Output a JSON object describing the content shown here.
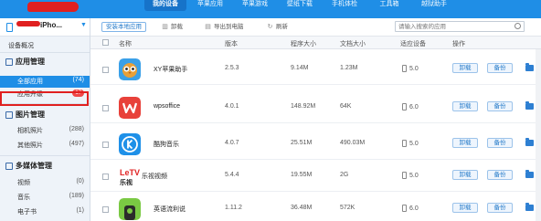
{
  "nav": {
    "items": [
      "我的设备",
      "苹果应用",
      "苹果游戏",
      "壁纸下载",
      "手机体检",
      "工具箱",
      "越狱助手"
    ],
    "active_index": 0
  },
  "sidebar": {
    "device_name": "iPho...",
    "device_overview": "设备概况",
    "app_section": "应用管理",
    "all_apps": "全部应用",
    "all_apps_count": "(74)",
    "app_updates": "应用升级",
    "app_updates_count": "17",
    "photo_section": "图片管理",
    "camera_photos": "相机照片",
    "camera_photos_count": "(288)",
    "other_photos": "其他照片",
    "other_photos_count": "(497)",
    "media_section": "多媒体管理",
    "video": "视频",
    "video_count": "(0)",
    "music": "音乐",
    "music_count": "(189)",
    "ebook": "电子书",
    "ebook_count": "(1)"
  },
  "toolbar": {
    "install_local": "安装本地应用",
    "uninstall": "卸载",
    "export_pc": "导出到电脑",
    "refresh": "刷新",
    "search_placeholder": "请输入搜索的应用"
  },
  "table": {
    "headers": {
      "name": "名称",
      "version": "版本",
      "app_size": "程序大小",
      "doc_size": "文档大小",
      "device": "适应设备",
      "actions": "操作"
    },
    "uninstall_label": "卸载",
    "backup_label": "备份",
    "rows": [
      {
        "name": "XY苹果助手",
        "version": "2.5.3",
        "app_size": "9.14M",
        "doc_size": "1.23M",
        "device": "5.0",
        "icon": "xy-owl-icon"
      },
      {
        "name": "wpsoffice",
        "version": "4.0.1",
        "app_size": "148.92M",
        "doc_size": "64K",
        "device": "6.0",
        "icon": "wps-icon"
      },
      {
        "name": "酷狗音乐",
        "version": "4.0.7",
        "app_size": "25.51M",
        "doc_size": "490.03M",
        "device": "5.0",
        "icon": "kugou-icon"
      },
      {
        "name": "乐视视频",
        "version": "5.4.4",
        "app_size": "19.55M",
        "doc_size": "2G",
        "device": "5.0",
        "icon": "letv-icon"
      },
      {
        "name": "英语流利说",
        "version": "1.11.2",
        "app_size": "36.48M",
        "doc_size": "572K",
        "device": "6.0",
        "icon": "liulishuo-icon"
      }
    ]
  }
}
